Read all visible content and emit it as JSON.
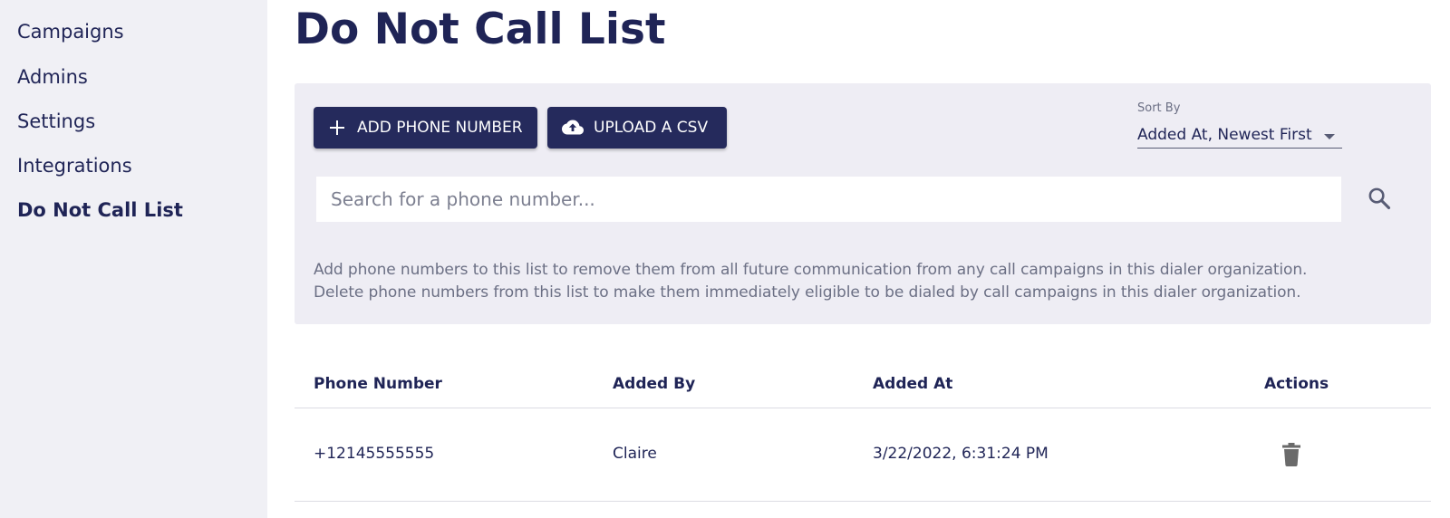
{
  "sidebar": {
    "items": [
      {
        "label": "Campaigns"
      },
      {
        "label": "Admins"
      },
      {
        "label": "Settings"
      },
      {
        "label": "Integrations"
      },
      {
        "label": "Do Not Call List"
      }
    ]
  },
  "page": {
    "title": "Do Not Call List"
  },
  "toolbar": {
    "add_label": "ADD PHONE NUMBER",
    "upload_label": "UPLOAD A CSV",
    "sort_label": "Sort By",
    "sort_value": "Added At, Newest First"
  },
  "search": {
    "placeholder": "Search for a phone number..."
  },
  "description": {
    "line1": "Add phone numbers to this list to remove them from all future communication from any call campaigns in this dialer organization.",
    "line2": "Delete phone numbers from this list to make them immediately eligible to be dialed by call campaigns in this dialer organization."
  },
  "table": {
    "headers": [
      "Phone Number",
      "Added By",
      "Added At",
      "Actions"
    ],
    "rows": [
      {
        "phone": "+12145555555",
        "added_by": "Claire",
        "added_at": "3/22/2022, 6:31:24 PM"
      }
    ]
  },
  "colors": {
    "primary": "#252a5c",
    "text": "#1f2456",
    "sidebar_bg": "#f0f0f5",
    "panel_bg": "#eeedf4"
  },
  "icons": {
    "add": "plus-icon",
    "upload": "cloud-upload-icon",
    "search": "search-icon",
    "delete": "trash-icon",
    "sort": "caret-down-icon"
  }
}
